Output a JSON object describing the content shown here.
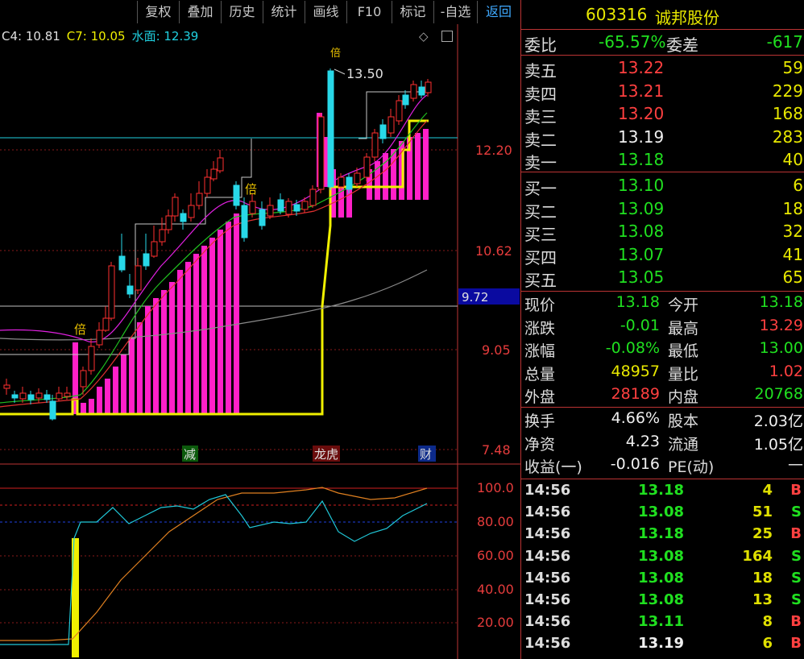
{
  "toolbar": {
    "buttons": [
      "复权",
      "叠加",
      "历史",
      "统计",
      "画线",
      "F10",
      "标记",
      "-自选",
      "返回"
    ]
  },
  "indicators": {
    "c4": "C4: 10.81",
    "c7": "C7: 10.05",
    "shuimian": "水面: 12.39"
  },
  "chart": {
    "price_axis": [
      "12.20",
      "10.62",
      "9.05",
      "7.48"
    ],
    "current_price_marker": "9.72",
    "peak_label": "13.50",
    "bei_label": "倍",
    "events": {
      "jian": "减",
      "longhu": "龙虎",
      "cai": "财"
    },
    "osc_axis": [
      "100.0",
      "80.00",
      "60.00",
      "40.00",
      "20.00"
    ],
    "colors": {
      "up": "#ff3030",
      "down": "#28d8e8",
      "vol": "#ff20c8",
      "yellow": "#f0f000",
      "cyan": "#20d0e0",
      "orange": "#e08020"
    }
  },
  "chart_data": {
    "type": "line",
    "title": "",
    "ylim": [
      7.0,
      14.0
    ],
    "y_ticks": [
      12.2,
      10.62,
      9.05,
      7.48
    ],
    "annotations": [
      "13.50",
      "9.72"
    ],
    "series": [
      {
        "name": "水面",
        "values": [
          12.39
        ]
      }
    ]
  },
  "panel": {
    "code": "603316",
    "name": "诚邦股份",
    "weibi": {
      "label": "委比",
      "value": "-65.57%",
      "label2": "委差",
      "value2": "-617"
    },
    "asks": [
      {
        "label": "卖五",
        "price": "13.22",
        "vol": "59"
      },
      {
        "label": "卖四",
        "price": "13.21",
        "vol": "229"
      },
      {
        "label": "卖三",
        "price": "13.20",
        "vol": "168"
      },
      {
        "label": "卖二",
        "price": "13.19",
        "vol": "283"
      },
      {
        "label": "卖一",
        "price": "13.18",
        "vol": "40"
      }
    ],
    "bids": [
      {
        "label": "买一",
        "price": "13.10",
        "vol": "6"
      },
      {
        "label": "买二",
        "price": "13.09",
        "vol": "18"
      },
      {
        "label": "买三",
        "price": "13.08",
        "vol": "32"
      },
      {
        "label": "买四",
        "price": "13.07",
        "vol": "41"
      },
      {
        "label": "买五",
        "price": "13.05",
        "vol": "65"
      }
    ],
    "quote": [
      {
        "l1": "现价",
        "v1": "13.18",
        "l2": "今开",
        "v2": "13.18"
      },
      {
        "l1": "涨跌",
        "v1": "-0.01",
        "l2": "最高",
        "v2": "13.29"
      },
      {
        "l1": "涨幅",
        "v1": "-0.08%",
        "l2": "最低",
        "v2": "13.00"
      },
      {
        "l1": "总量",
        "v1": "48957",
        "l2": "量比",
        "v2": "1.02"
      },
      {
        "l1": "外盘",
        "v1": "28189",
        "l2": "内盘",
        "v2": "20768"
      }
    ],
    "fund": [
      {
        "l1": "换手",
        "v1": "4.66%",
        "l2": "股本",
        "v2": "2.03亿"
      },
      {
        "l1": "净资",
        "v1": "4.23",
        "l2": "流通",
        "v2": "1.05亿"
      },
      {
        "l1": "收益(一)",
        "v1": "-0.016",
        "l2": "PE(动)",
        "v2": "—"
      }
    ],
    "ticks": [
      {
        "t": "14:56",
        "p": "13.18",
        "v": "4",
        "s": "B"
      },
      {
        "t": "14:56",
        "p": "13.08",
        "v": "51",
        "s": "S"
      },
      {
        "t": "14:56",
        "p": "13.18",
        "v": "25",
        "s": "B"
      },
      {
        "t": "14:56",
        "p": "13.08",
        "v": "164",
        "s": "S"
      },
      {
        "t": "14:56",
        "p": "13.08",
        "v": "18",
        "s": "S"
      },
      {
        "t": "14:56",
        "p": "13.08",
        "v": "13",
        "s": "S"
      },
      {
        "t": "14:56",
        "p": "13.11",
        "v": "8",
        "s": "B"
      },
      {
        "t": "14:56",
        "p": "13.19",
        "v": "6",
        "s": "B"
      }
    ]
  }
}
